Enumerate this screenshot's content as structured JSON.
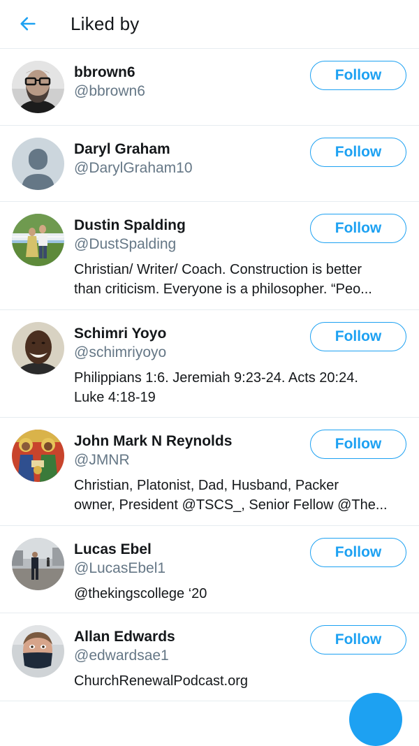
{
  "header": {
    "title": "Liked by",
    "back_icon": "arrow-left-icon",
    "accent_color": "#1da1f2"
  },
  "users": [
    {
      "name": "bbrown6",
      "handle": "@bbrown6",
      "bio_lines": [],
      "follow_label": "Follow",
      "avatar": "bearded-man-glasses"
    },
    {
      "name": "Daryl Graham",
      "handle": "@DarylGraham10",
      "bio_lines": [],
      "follow_label": "Follow",
      "avatar": "default-silhouette"
    },
    {
      "name": "Dustin Spalding",
      "handle": "@DustSpalding",
      "bio_lines": [
        "Christian/ Writer/ Coach. Construction is better",
        "than criticism. Everyone is a philosopher. “Peo..."
      ],
      "follow_label": "Follow",
      "avatar": "couple-outdoors"
    },
    {
      "name": "Schimri Yoyo",
      "handle": "@schimriyoyo",
      "bio_lines": [
        "Philippians 1:6. Jeremiah 9:23-24. Acts 20:24.",
        "Luke 4:18-19"
      ],
      "follow_label": "Follow",
      "avatar": "smiling-man"
    },
    {
      "name": "John Mark N Reynolds",
      "handle": "@JMNR",
      "bio_lines": [
        "Christian, Platonist, Dad, Husband, Packer",
        "owner, President @TSCS_, Senior Fellow @The..."
      ],
      "follow_label": "Follow",
      "avatar": "icon-painting"
    },
    {
      "name": "Lucas Ebel",
      "handle": "@LucasEbel1",
      "bio_lines": [
        "@thekingscollege ‘20"
      ],
      "follow_label": "Follow",
      "avatar": "man-plaza"
    },
    {
      "name": "Allan Edwards",
      "handle": "@edwardsae1",
      "bio_lines": [
        "ChurchRenewalPodcast.org"
      ],
      "follow_label": "Follow",
      "avatar": "man-with-mask"
    }
  ]
}
